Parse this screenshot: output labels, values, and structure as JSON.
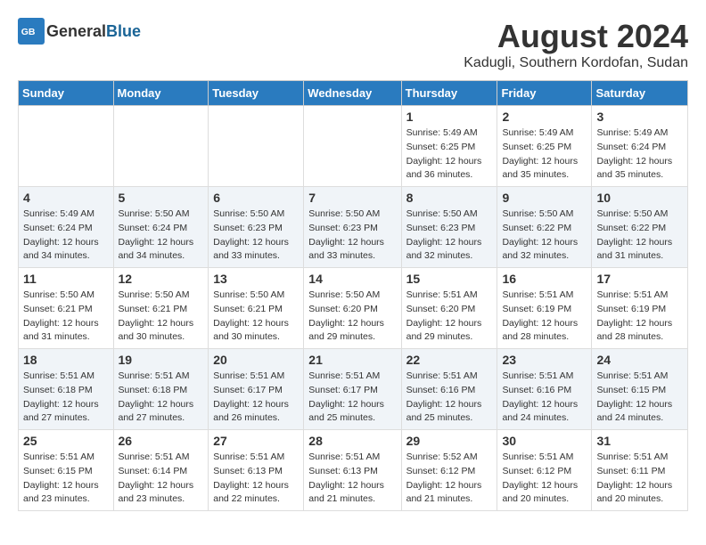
{
  "header": {
    "logo_general": "General",
    "logo_blue": "Blue",
    "month_year": "August 2024",
    "location": "Kadugli, Southern Kordofan, Sudan"
  },
  "days_of_week": [
    "Sunday",
    "Monday",
    "Tuesday",
    "Wednesday",
    "Thursday",
    "Friday",
    "Saturday"
  ],
  "weeks": [
    [
      {
        "day": "",
        "sunrise": "",
        "sunset": "",
        "daylight": ""
      },
      {
        "day": "",
        "sunrise": "",
        "sunset": "",
        "daylight": ""
      },
      {
        "day": "",
        "sunrise": "",
        "sunset": "",
        "daylight": ""
      },
      {
        "day": "",
        "sunrise": "",
        "sunset": "",
        "daylight": ""
      },
      {
        "day": "1",
        "sunrise": "Sunrise: 5:49 AM",
        "sunset": "Sunset: 6:25 PM",
        "daylight": "Daylight: 12 hours and 36 minutes."
      },
      {
        "day": "2",
        "sunrise": "Sunrise: 5:49 AM",
        "sunset": "Sunset: 6:25 PM",
        "daylight": "Daylight: 12 hours and 35 minutes."
      },
      {
        "day": "3",
        "sunrise": "Sunrise: 5:49 AM",
        "sunset": "Sunset: 6:24 PM",
        "daylight": "Daylight: 12 hours and 35 minutes."
      }
    ],
    [
      {
        "day": "4",
        "sunrise": "Sunrise: 5:49 AM",
        "sunset": "Sunset: 6:24 PM",
        "daylight": "Daylight: 12 hours and 34 minutes."
      },
      {
        "day": "5",
        "sunrise": "Sunrise: 5:50 AM",
        "sunset": "Sunset: 6:24 PM",
        "daylight": "Daylight: 12 hours and 34 minutes."
      },
      {
        "day": "6",
        "sunrise": "Sunrise: 5:50 AM",
        "sunset": "Sunset: 6:23 PM",
        "daylight": "Daylight: 12 hours and 33 minutes."
      },
      {
        "day": "7",
        "sunrise": "Sunrise: 5:50 AM",
        "sunset": "Sunset: 6:23 PM",
        "daylight": "Daylight: 12 hours and 33 minutes."
      },
      {
        "day": "8",
        "sunrise": "Sunrise: 5:50 AM",
        "sunset": "Sunset: 6:23 PM",
        "daylight": "Daylight: 12 hours and 32 minutes."
      },
      {
        "day": "9",
        "sunrise": "Sunrise: 5:50 AM",
        "sunset": "Sunset: 6:22 PM",
        "daylight": "Daylight: 12 hours and 32 minutes."
      },
      {
        "day": "10",
        "sunrise": "Sunrise: 5:50 AM",
        "sunset": "Sunset: 6:22 PM",
        "daylight": "Daylight: 12 hours and 31 minutes."
      }
    ],
    [
      {
        "day": "11",
        "sunrise": "Sunrise: 5:50 AM",
        "sunset": "Sunset: 6:21 PM",
        "daylight": "Daylight: 12 hours and 31 minutes."
      },
      {
        "day": "12",
        "sunrise": "Sunrise: 5:50 AM",
        "sunset": "Sunset: 6:21 PM",
        "daylight": "Daylight: 12 hours and 30 minutes."
      },
      {
        "day": "13",
        "sunrise": "Sunrise: 5:50 AM",
        "sunset": "Sunset: 6:21 PM",
        "daylight": "Daylight: 12 hours and 30 minutes."
      },
      {
        "day": "14",
        "sunrise": "Sunrise: 5:50 AM",
        "sunset": "Sunset: 6:20 PM",
        "daylight": "Daylight: 12 hours and 29 minutes."
      },
      {
        "day": "15",
        "sunrise": "Sunrise: 5:51 AM",
        "sunset": "Sunset: 6:20 PM",
        "daylight": "Daylight: 12 hours and 29 minutes."
      },
      {
        "day": "16",
        "sunrise": "Sunrise: 5:51 AM",
        "sunset": "Sunset: 6:19 PM",
        "daylight": "Daylight: 12 hours and 28 minutes."
      },
      {
        "day": "17",
        "sunrise": "Sunrise: 5:51 AM",
        "sunset": "Sunset: 6:19 PM",
        "daylight": "Daylight: 12 hours and 28 minutes."
      }
    ],
    [
      {
        "day": "18",
        "sunrise": "Sunrise: 5:51 AM",
        "sunset": "Sunset: 6:18 PM",
        "daylight": "Daylight: 12 hours and 27 minutes."
      },
      {
        "day": "19",
        "sunrise": "Sunrise: 5:51 AM",
        "sunset": "Sunset: 6:18 PM",
        "daylight": "Daylight: 12 hours and 27 minutes."
      },
      {
        "day": "20",
        "sunrise": "Sunrise: 5:51 AM",
        "sunset": "Sunset: 6:17 PM",
        "daylight": "Daylight: 12 hours and 26 minutes."
      },
      {
        "day": "21",
        "sunrise": "Sunrise: 5:51 AM",
        "sunset": "Sunset: 6:17 PM",
        "daylight": "Daylight: 12 hours and 25 minutes."
      },
      {
        "day": "22",
        "sunrise": "Sunrise: 5:51 AM",
        "sunset": "Sunset: 6:16 PM",
        "daylight": "Daylight: 12 hours and 25 minutes."
      },
      {
        "day": "23",
        "sunrise": "Sunrise: 5:51 AM",
        "sunset": "Sunset: 6:16 PM",
        "daylight": "Daylight: 12 hours and 24 minutes."
      },
      {
        "day": "24",
        "sunrise": "Sunrise: 5:51 AM",
        "sunset": "Sunset: 6:15 PM",
        "daylight": "Daylight: 12 hours and 24 minutes."
      }
    ],
    [
      {
        "day": "25",
        "sunrise": "Sunrise: 5:51 AM",
        "sunset": "Sunset: 6:15 PM",
        "daylight": "Daylight: 12 hours and 23 minutes."
      },
      {
        "day": "26",
        "sunrise": "Sunrise: 5:51 AM",
        "sunset": "Sunset: 6:14 PM",
        "daylight": "Daylight: 12 hours and 23 minutes."
      },
      {
        "day": "27",
        "sunrise": "Sunrise: 5:51 AM",
        "sunset": "Sunset: 6:13 PM",
        "daylight": "Daylight: 12 hours and 22 minutes."
      },
      {
        "day": "28",
        "sunrise": "Sunrise: 5:51 AM",
        "sunset": "Sunset: 6:13 PM",
        "daylight": "Daylight: 12 hours and 21 minutes."
      },
      {
        "day": "29",
        "sunrise": "Sunrise: 5:52 AM",
        "sunset": "Sunset: 6:12 PM",
        "daylight": "Daylight: 12 hours and 21 minutes."
      },
      {
        "day": "30",
        "sunrise": "Sunrise: 5:51 AM",
        "sunset": "Sunset: 6:12 PM",
        "daylight": "Daylight: 12 hours and 20 minutes."
      },
      {
        "day": "31",
        "sunrise": "Sunrise: 5:51 AM",
        "sunset": "Sunset: 6:11 PM",
        "daylight": "Daylight: 12 hours and 20 minutes."
      }
    ]
  ]
}
